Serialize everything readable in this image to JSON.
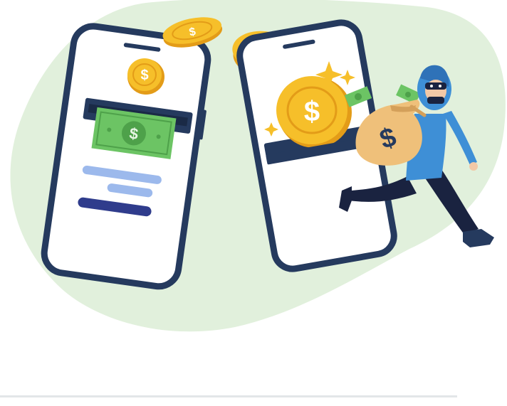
{
  "illustration": {
    "subject": "mobile-payment-fraud",
    "elements": [
      "left-phone",
      "right-phone",
      "gold-coin",
      "cash-bill",
      "thief",
      "money-bag",
      "sparkle"
    ],
    "colors": {
      "background_blob": "#e1f0dc",
      "phone_frame": "#253a5e",
      "phone_screen": "#ffffff",
      "coin_gold": "#f6bf2a",
      "coin_dark": "#e39c18",
      "bill_green": "#6cc464",
      "thief_hoodie": "#3e8fd6",
      "thief_pants": "#1a2340",
      "bag": "#efc07a",
      "ui_bar_light": "#9cb9ec",
      "ui_bar_dark": "#2f3c8c",
      "divider": "#e3e6e8"
    },
    "symbol": "$"
  }
}
